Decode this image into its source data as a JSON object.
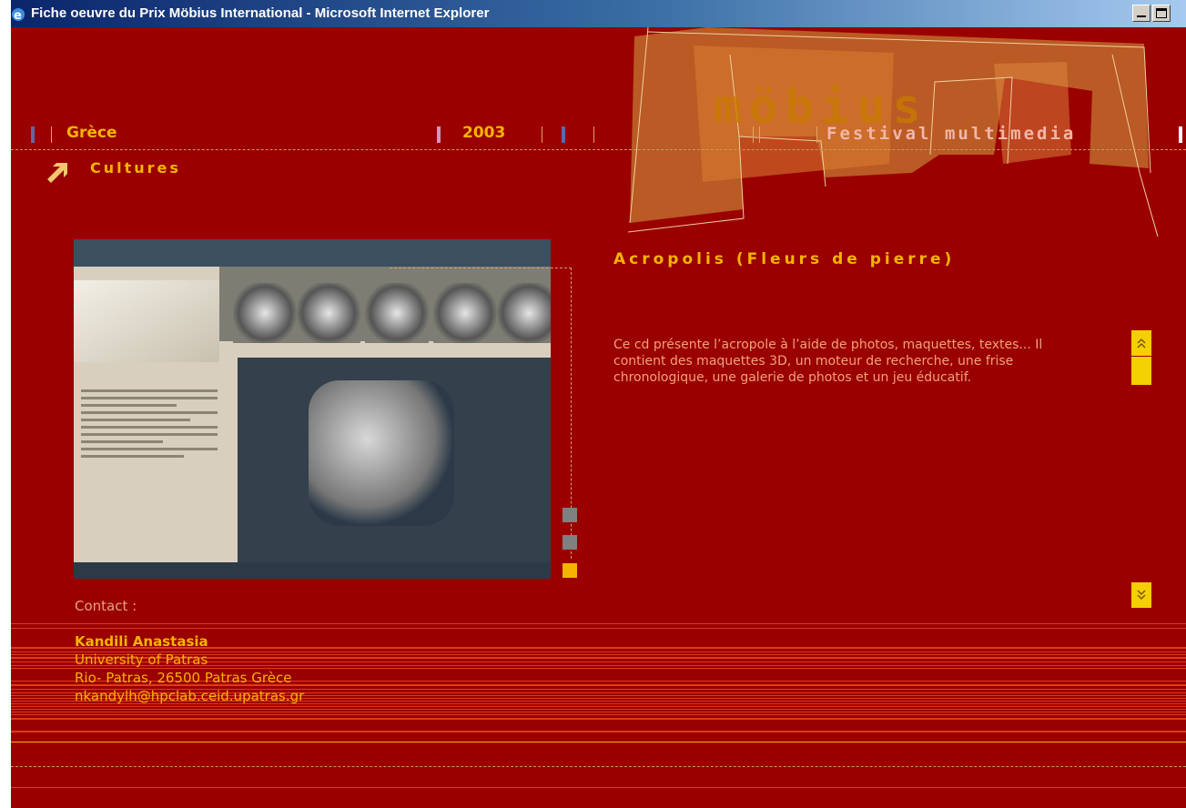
{
  "window": {
    "title": "Fiche oeuvre du Prix Möbius International - Microsoft Internet Explorer"
  },
  "header": {
    "country": "Grèce",
    "year": "2003",
    "logo": "möbius",
    "tagline": "Festival multimedia"
  },
  "section": {
    "label": "Cultures"
  },
  "work": {
    "title": "Acropolis (Fleurs de pierre)",
    "description": "Ce cd présente l’acropole à l’aide de photos, maquettes, textes... Il contient des maquettes 3D, un moteur de recherche, une frise chronologique, une galerie de photos et un jeu éducatif."
  },
  "contact": {
    "label": "Contact :",
    "name": "Kandili Anastasia",
    "institution": "University of Patras",
    "address": "Rio- Patras, 26500 Patras Grèce",
    "email": "nkandylh@hpclab.ceid.upatras.gr"
  },
  "icons": {
    "arrow": "arrow-up-right-icon",
    "scroll_up": "double-chevron-up-icon",
    "scroll_down": "double-chevron-down-icon"
  },
  "colors": {
    "background": "#9a0000",
    "accent": "#f5b400",
    "text_secondary": "#f2a27a"
  }
}
